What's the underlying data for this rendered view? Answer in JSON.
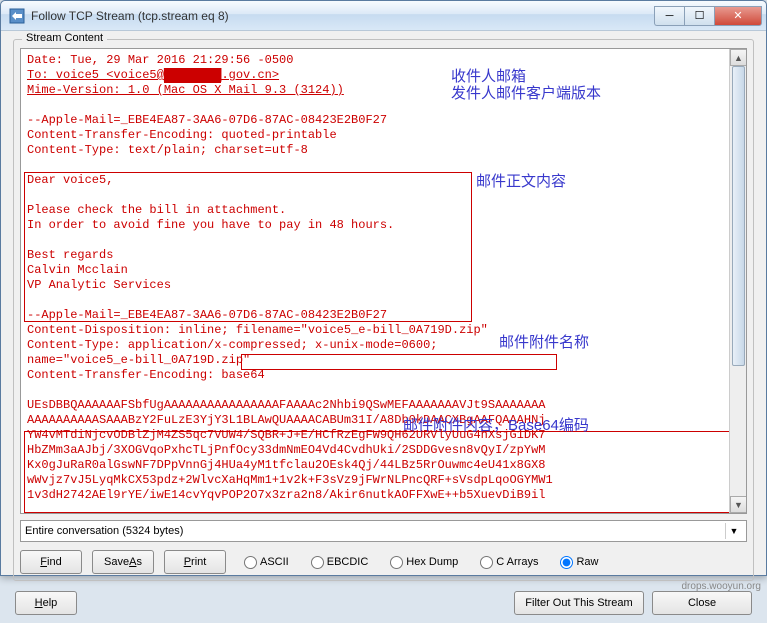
{
  "window": {
    "title": "Follow TCP Stream (tcp.stream eq 8)"
  },
  "fieldset": {
    "label": "Stream Content"
  },
  "stream": {
    "line1": "Date: Tue, 29 Mar 2016 21:29:56 -0500",
    "line2a": "To: voice5 <voice5@",
    "line2b": ".gov.cn>",
    "line3": "Mime-Version: 1.0 (Mac OS X Mail 9.3 (3124))",
    "blank": "",
    "line5": "--Apple-Mail=_EBE4EA87-3AA6-07D6-87AC-08423E2B0F27",
    "line6": "Content-Transfer-Encoding: quoted-printable",
    "line7": "Content-Type: text/plain; charset=utf-8",
    "body1": "Dear voice5,",
    "body2": "Please check the bill in attachment.",
    "body3": "In order to avoid fine you have to pay in 48 hours.",
    "body4": "Best regards",
    "body5": "Calvin Mcclain",
    "body6": "VP Analytic Services",
    "line16": "--Apple-Mail=_EBE4EA87-3AA6-07D6-87AC-08423E2B0F27",
    "line17a": "Content-Disposition: inline; ",
    "line17b": "filename=\"voice5_e-bill_0A719D.zip\"",
    "line18": "Content-Type: application/x-compressed; x-unix-mode=0600;",
    "line19": "name=\"voice5_e-bill_0A719D.zip\"",
    "line20": "Content-Transfer-Encoding: base64",
    "b64_1": "UEsDBBQAAAAAAFSbfUgAAAAAAAAAAAAAAAAFAAAAc2Nhbi9QSwMEFAAAAAAAVJt9SAAAAAAA",
    "b64_2": "AAAAAAAAAASAAABzY2FuLzE3YjY3L1BLAwQUAAAACABUm31I/A8Db0kDAACXBgAAFQAAAHNj",
    "b64_3": "YW4vMTdiNjcvODBlZjM4ZS5qc7VUW4/SQBR+J+E/HCfRzEgFW9QH62URVlyUuG4hXsjG1DK7",
    "b64_4": "HbZMm3aAJbj/3XOGVqoPxhcTLjPnfOcy33dmNmEO4Vd4CvdhUki/2SDDGvesn8vQyI/zpYwM",
    "b64_5": "Kx0gJuRaR0alGswNF7DPpVnnGj4HUa4yM1tfclau2OEsk4Qj/44LBz5RrOuwmc4eU41x8GX8",
    "b64_6": "wWvjz7vJ5LyqMkCX53pdz+2WlvcXaHqMm1+1v2k+F3sVz9jFWrNLPncQRF+sVsdpLqoOGYMW1",
    "b64_7": "1v3dH2742AEl9rYE/iwE14cvYqvPOP2O7x3zra2n8/Akir6nutkAOFFXwE++b5XuevDiB9il"
  },
  "dropdown": {
    "selected": "Entire conversation (5324 bytes)"
  },
  "buttons": {
    "find": "Find",
    "saveas": "Save As",
    "print": "Print",
    "help": "Help",
    "filter": "Filter Out This Stream",
    "close": "Close"
  },
  "radios": {
    "ascii": "ASCII",
    "ebcdic": "EBCDIC",
    "hexdump": "Hex Dump",
    "carrays": "C Arrays",
    "raw": "Raw"
  },
  "annotations": {
    "a1": "收件人邮箱",
    "a2": "发件人邮件客户端版本",
    "a3": "邮件正文内容",
    "a4": "邮件附件名称",
    "a5": "邮件附件内容，Base64编码"
  },
  "watermark": "drops.wooyun.org"
}
